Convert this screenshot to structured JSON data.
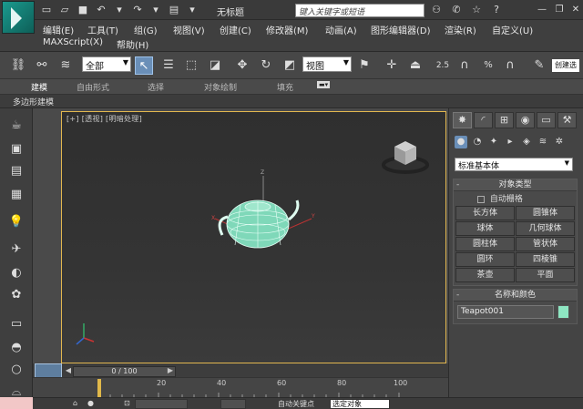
{
  "titlebar": {
    "title": "无标题",
    "search_placeholder": "键入关键字或短语"
  },
  "menu": {
    "row1": [
      "编辑(E)",
      "工具(T)",
      "组(G)",
      "视图(V)",
      "创建(C)",
      "修改器(M)",
      "动画(A)",
      "图形编辑器(D)",
      "渲染(R)",
      "自定义(U)"
    ],
    "row2": [
      "MAXScript(X)",
      "帮助(H)"
    ]
  },
  "toolbar": {
    "selection_filter": "全部",
    "coord_system": "视图",
    "snap_labels": [
      "2.5",
      "%"
    ],
    "right_button": "创建选"
  },
  "ribbon": {
    "tabs": [
      "建模",
      "自由形式",
      "选择",
      "对象绘制",
      "填充"
    ],
    "active": "建模",
    "sub_label": "多边形建模"
  },
  "viewport": {
    "label": "[+] [透视] [明暗处理]",
    "axis_x": "X",
    "axis_y": "Y",
    "axis_z": "Z"
  },
  "command_panel": {
    "category_dropdown": "标准基本体",
    "object_type_header": "对象类型",
    "auto_grid": "自动栅格",
    "objects": [
      "长方体",
      "圆锥体",
      "球体",
      "几何球体",
      "圆柱体",
      "管状体",
      "圆环",
      "四棱锥",
      "茶壶",
      "平面"
    ],
    "name_color_header": "名称和颜色",
    "object_name": "Teapot001",
    "object_color": "#8ee6c2"
  },
  "timeline": {
    "slider_text": "0 / 100",
    "ruler": [
      "20",
      "40",
      "60",
      "80",
      "100"
    ]
  },
  "status": {
    "auto_key": "自动关键点",
    "selected": "选定对象"
  }
}
